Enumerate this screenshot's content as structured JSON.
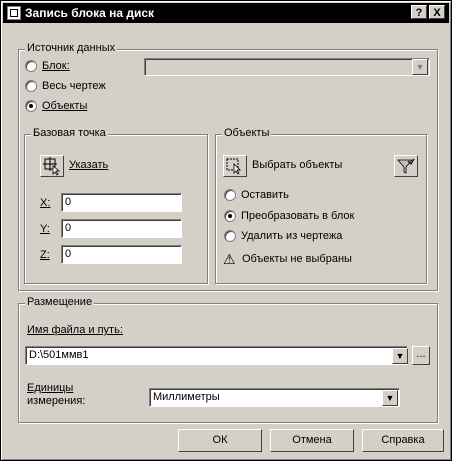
{
  "window": {
    "title": "Запись блока на диск",
    "help_label": "?",
    "close_label": "X"
  },
  "source": {
    "legend": "Источник данных",
    "block_label": "Блок:",
    "block_value": "",
    "drawing_label": "Весь чертеж",
    "objects_label": "Объекты",
    "selected": "objects"
  },
  "base_point": {
    "legend": "Базовая точка",
    "pick_label": "Указать",
    "x_label": "X:",
    "x_value": "0",
    "y_label": "Y:",
    "y_value": "0",
    "z_label": "Z:",
    "z_value": "0"
  },
  "objects": {
    "legend": "Объекты",
    "select_label": "Выбрать объекты",
    "retain_label": "Оставить",
    "convert_label": "Преобразовать в блок",
    "delete_label": "Удалить из чертежа",
    "selected": "convert",
    "warning": "Объекты не выбраны"
  },
  "destination": {
    "legend": "Размещение",
    "path_label": "Имя файла и путь:",
    "path_value": "D:\\501ммв1",
    "browse_label": "...",
    "units_label_1": "Единицы",
    "units_label_2": "измерения:",
    "units_value": "Миллиметры"
  },
  "footer": {
    "ok_label": "ОК",
    "cancel_label": "Отмена",
    "help_label": "Справка"
  },
  "icons": {
    "dropdown": "▼",
    "warning": "⚠"
  }
}
